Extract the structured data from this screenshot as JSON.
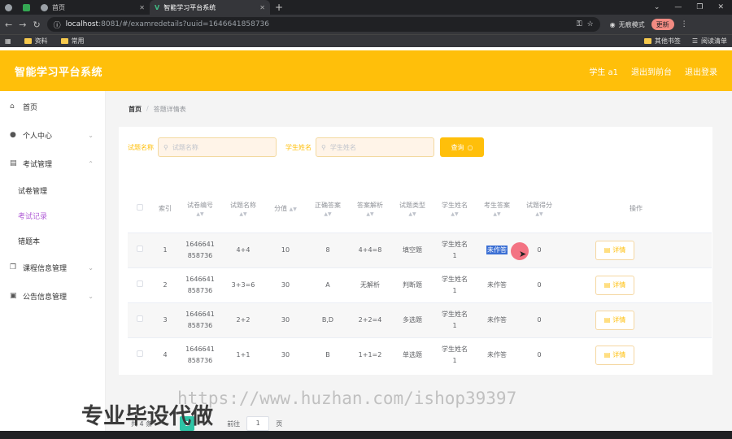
{
  "browser": {
    "tabs": [
      {
        "title": ""
      },
      {
        "title": ""
      },
      {
        "title": "首页"
      },
      {
        "title": "智能学习平台系统"
      }
    ],
    "new_tab": "+",
    "url_host": "localhost",
    "url_path": ":8081/#/examredetails?uuid=1646641858736",
    "incognito_label": "无痕模式",
    "update_label": "更新",
    "bookmarks": [
      "资料",
      "常用"
    ],
    "bookmarks_right": [
      "其他书签",
      "阅读清单"
    ]
  },
  "header": {
    "brand": "智能学习平台系统",
    "links": [
      "学生 a1",
      "退出到前台",
      "退出登录"
    ]
  },
  "sidebar": {
    "items": [
      {
        "label": "首页",
        "icon": "home-icon"
      },
      {
        "label": "个人中心",
        "icon": "user-icon",
        "expandable": true
      },
      {
        "label": "考试管理",
        "icon": "exam-icon",
        "expandable": true,
        "expanded": true
      },
      {
        "label": "课程信息管理",
        "icon": "course-icon",
        "expandable": true
      },
      {
        "label": "公告信息管理",
        "icon": "notice-icon",
        "expandable": true
      }
    ],
    "sub_items": [
      {
        "label": "试卷管理"
      },
      {
        "label": "考试记录",
        "active": true
      },
      {
        "label": "错题本"
      }
    ]
  },
  "breadcrumb": {
    "home": "首页",
    "separator": "/",
    "current": "答题详情表"
  },
  "search": {
    "field1_label": "试题名称",
    "field1_placeholder": "试题名称",
    "field2_label": "学生姓名",
    "field2_placeholder": "学生姓名",
    "query_button": "查询"
  },
  "table": {
    "headers": [
      "索引",
      "试卷编号",
      "试题名称",
      "分值",
      "正确答案",
      "答案解析",
      "试题类型",
      "学生姓名",
      "考生答案",
      "试题得分",
      "操作"
    ],
    "detail_label": "详情",
    "rows": [
      {
        "index": "1",
        "paper_id_1": "1646641",
        "paper_id_2": "858736",
        "question": "4+4",
        "score": "10",
        "answer": "8",
        "analysis": "4+4=8",
        "type": "填空题",
        "student_1": "学生姓名",
        "student_2": "1",
        "student_answer": "未作答",
        "got": "0",
        "highlight": true
      },
      {
        "index": "2",
        "paper_id_1": "1646641",
        "paper_id_2": "858736",
        "question": "3+3=6",
        "score": "30",
        "answer": "A",
        "analysis": "无解析",
        "type": "判断题",
        "student_1": "学生姓名",
        "student_2": "1",
        "student_answer": "未作答",
        "got": "0"
      },
      {
        "index": "3",
        "paper_id_1": "1646641",
        "paper_id_2": "858736",
        "question": "2+2",
        "score": "30",
        "answer": "B,D",
        "analysis": "2+2=4",
        "type": "多选题",
        "student_1": "学生姓名",
        "student_2": "1",
        "student_answer": "未作答",
        "got": "0"
      },
      {
        "index": "4",
        "paper_id_1": "1646641",
        "paper_id_2": "858736",
        "question": "1+1",
        "score": "30",
        "answer": "B",
        "analysis": "1+1=2",
        "type": "单选题",
        "student_1": "学生姓名",
        "student_2": "1",
        "student_answer": "未作答",
        "got": "0"
      }
    ]
  },
  "pagination": {
    "total": "共 4 条",
    "prev": "‹",
    "page": "1",
    "next": "›",
    "goto": "前往",
    "goto_value": "1",
    "page_unit": "页"
  },
  "watermark": {
    "url": "https://www.huzhan.com/ishop39397",
    "text": "专业毕设代做"
  },
  "colors": {
    "accent": "#ffbf0a",
    "active_menu": "#b05cd6",
    "page_active": "#2ec4a6"
  }
}
